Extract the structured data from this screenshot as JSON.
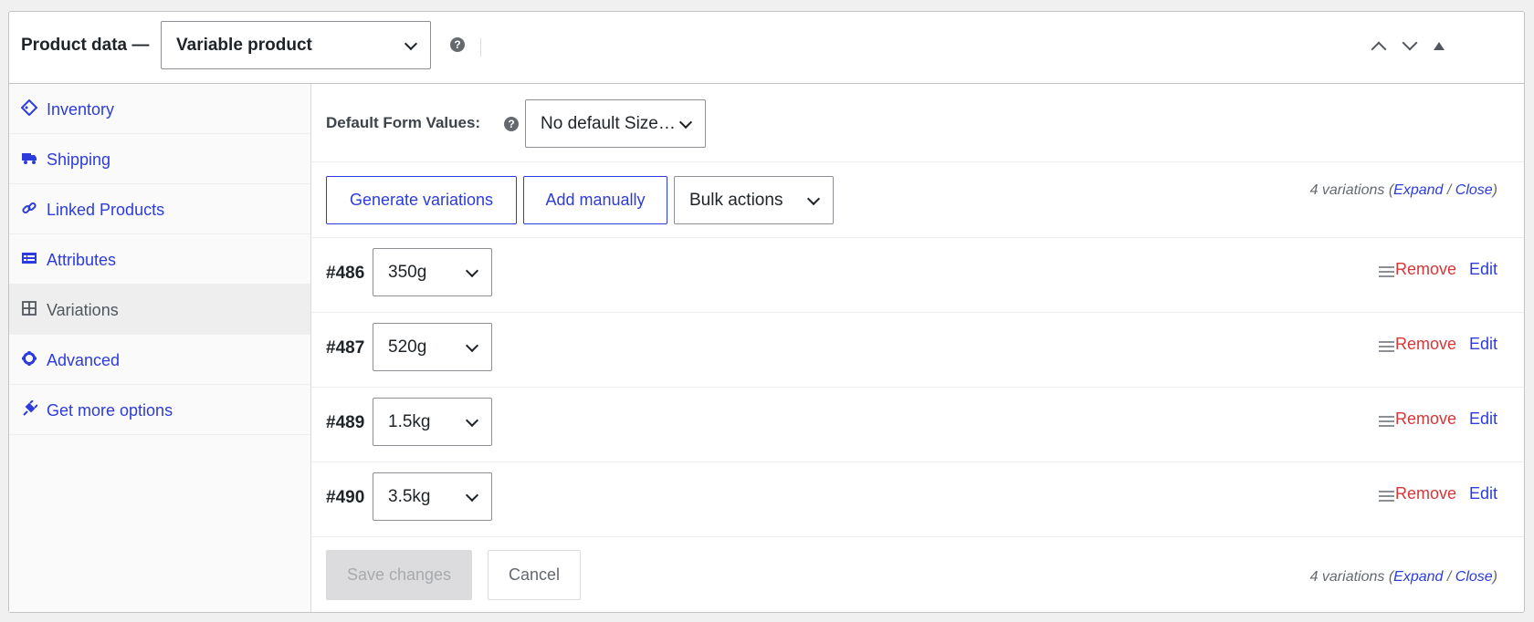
{
  "header": {
    "title": "Product data —",
    "product_type": "Variable product",
    "help": "?"
  },
  "sidebar": {
    "items": [
      {
        "label": "Inventory",
        "icon": "tag-icon"
      },
      {
        "label": "Shipping",
        "icon": "truck-icon"
      },
      {
        "label": "Linked Products",
        "icon": "link-icon"
      },
      {
        "label": "Attributes",
        "icon": "list-icon"
      },
      {
        "label": "Variations",
        "icon": "grid-icon",
        "active": true
      },
      {
        "label": "Advanced",
        "icon": "gear-icon"
      },
      {
        "label": "Get more options",
        "icon": "plugin-icon"
      }
    ]
  },
  "defaults": {
    "label": "Default Form Values:",
    "help": "?",
    "value": "No default Size…"
  },
  "toolbar": {
    "generate_label": "Generate variations",
    "add_label": "Add manually",
    "bulk_label": "Bulk actions"
  },
  "summary": {
    "count_text": "4 variations (",
    "expand": "Expand",
    "separator": " / ",
    "close": "Close",
    "end": ")"
  },
  "variations": [
    {
      "id": "#486",
      "value": "350g"
    },
    {
      "id": "#487",
      "value": "520g"
    },
    {
      "id": "#489",
      "value": "1.5kg"
    },
    {
      "id": "#490",
      "value": "3.5kg"
    }
  ],
  "row_actions": {
    "remove": "Remove",
    "edit": "Edit"
  },
  "footer": {
    "save_label": "Save changes",
    "cancel_label": "Cancel"
  },
  "colors": {
    "link": "#2c3cdc",
    "remove": "#d63638",
    "border": "#c3c4c7"
  }
}
